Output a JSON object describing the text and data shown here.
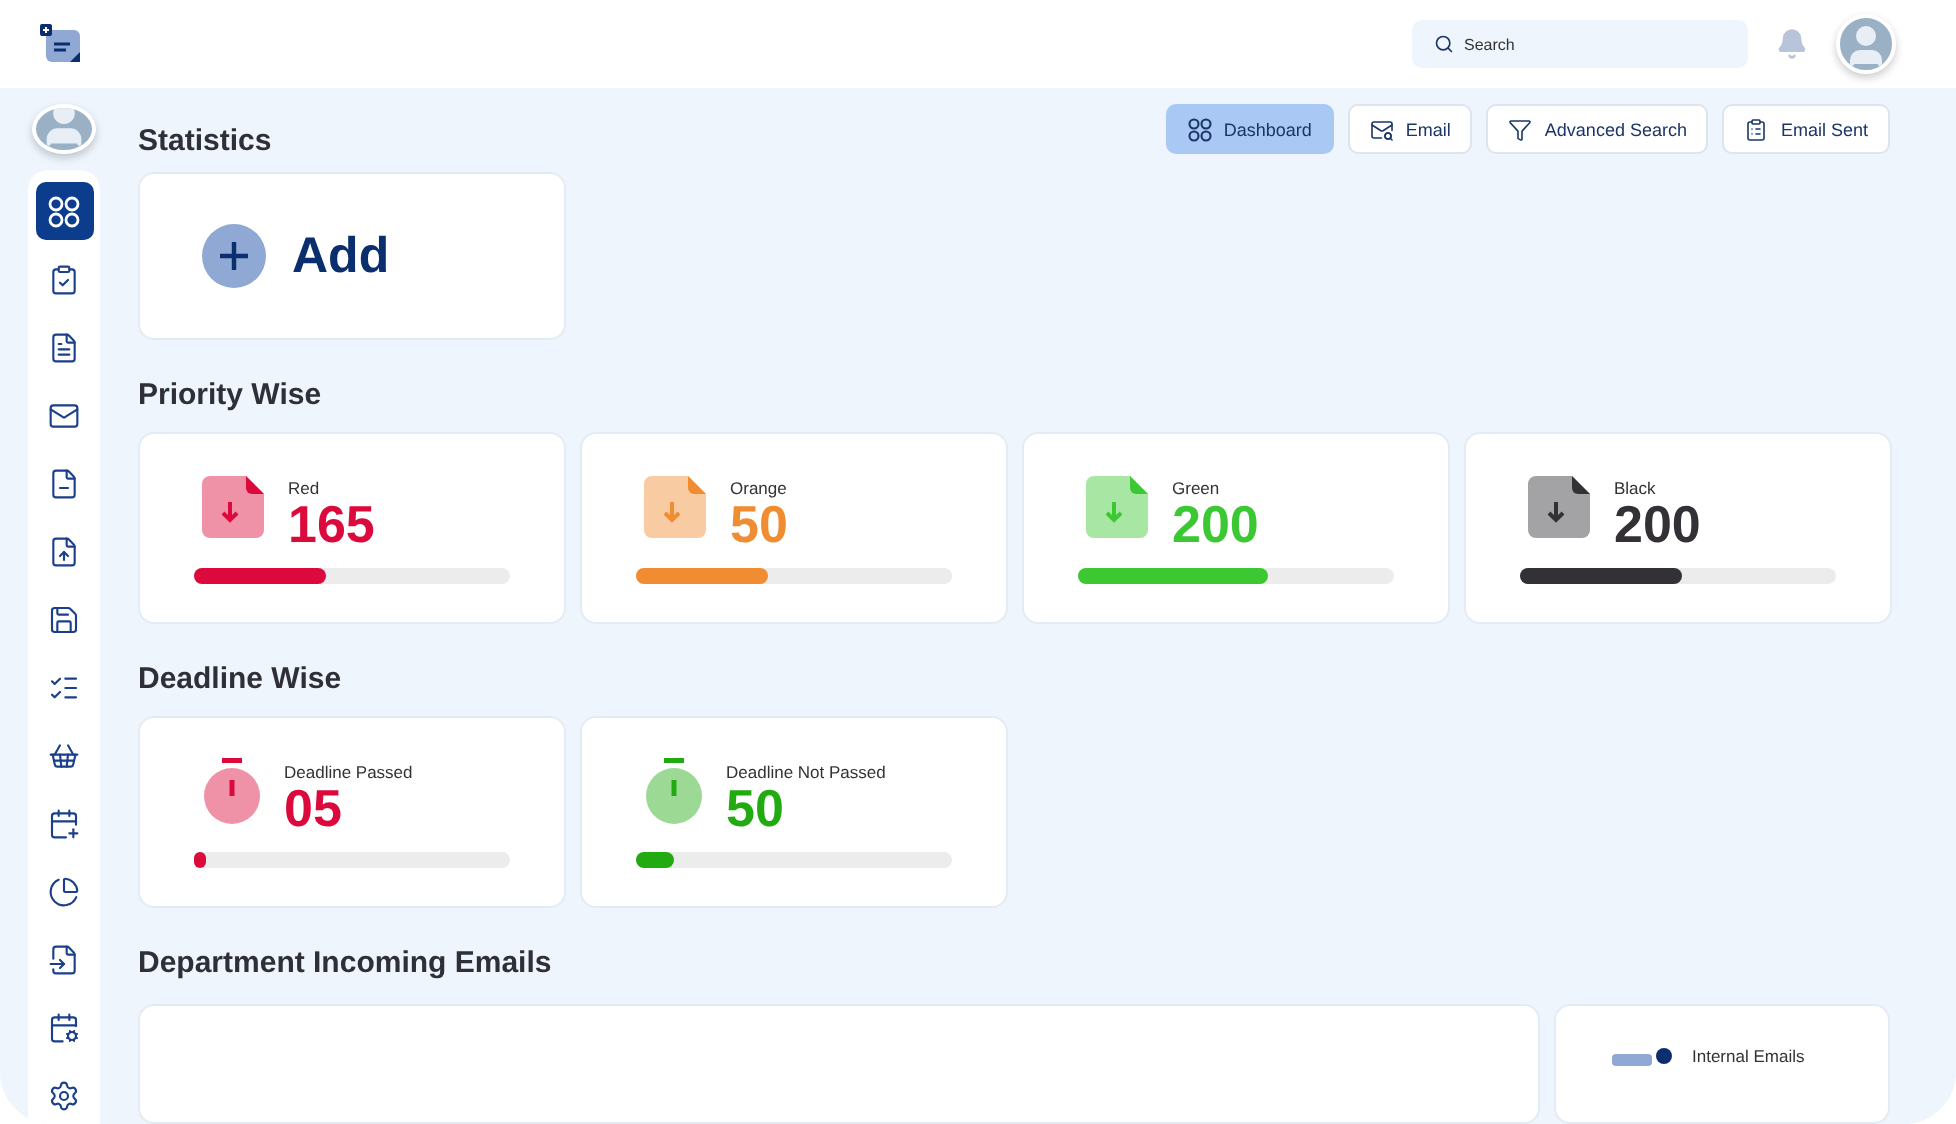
{
  "header": {
    "search": {
      "placeholder": "Search"
    }
  },
  "sidebar": {
    "items": [
      {
        "selected": true
      },
      {
        "selected": false
      },
      {
        "selected": false
      },
      {
        "selected": false
      },
      {
        "selected": false
      },
      {
        "selected": false
      },
      {
        "selected": false
      },
      {
        "selected": false
      },
      {
        "selected": false
      },
      {
        "selected": false
      },
      {
        "selected": false
      },
      {
        "selected": false
      },
      {
        "selected": false
      },
      {
        "selected": false
      }
    ]
  },
  "title": "Statistics",
  "tabs": [
    {
      "label": "Dashboard",
      "selected": true
    },
    {
      "label": "Email",
      "selected": false
    },
    {
      "label": "Advanced Search",
      "selected": false
    },
    {
      "label": "Email Sent",
      "selected": false
    }
  ],
  "add_card": {
    "label": "Add"
  },
  "priority": {
    "title": "Priority Wise",
    "cards": [
      {
        "label": "Red",
        "value": "165",
        "level": 0.42,
        "color": "#dc0a3c"
      },
      {
        "label": "Orange",
        "value": "50",
        "level": 0.42,
        "color": "#f08c32"
      },
      {
        "label": "Green",
        "value": "200",
        "level": 0.6,
        "color": "#3cc832"
      },
      {
        "label": "Black",
        "value": "200",
        "level": 0.51,
        "color": "#333036"
      }
    ]
  },
  "deadline": {
    "title": "Deadline Wise",
    "cards": [
      {
        "label": "Deadline Passed",
        "value": "05",
        "level": 0.04,
        "color": "#dc0a3c"
      },
      {
        "label": "Deadline Not Passed",
        "value": "50",
        "level": 0.12,
        "color": "#22aa11"
      }
    ]
  },
  "department": {
    "title": "Department Incoming Emails",
    "side_card": {
      "label": "Internal Emails"
    }
  }
}
